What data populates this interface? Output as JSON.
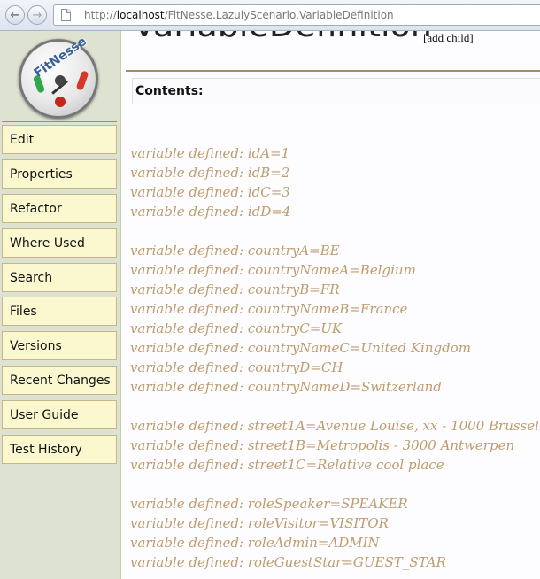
{
  "browser": {
    "url_prefix": "http://",
    "url_host": "localhost",
    "url_path": "/FitNesse.LazulyScenario.VariableDefinition",
    "back_glyph": "←",
    "forward_glyph": "→"
  },
  "logo": {
    "text": "FitNesse"
  },
  "sidebar": {
    "items": [
      {
        "label": "Edit"
      },
      {
        "label": "Properties"
      },
      {
        "label": "Refactor"
      },
      {
        "label": "Where Used"
      },
      {
        "label": "Search"
      },
      {
        "label": "Files"
      },
      {
        "label": "Versions"
      },
      {
        "label": "Recent Changes"
      },
      {
        "label": "User Guide"
      },
      {
        "label": "Test History"
      }
    ]
  },
  "main": {
    "title": "VariableDefinition",
    "add_child": "[add child]",
    "contents_label": "Contents:",
    "lines": [
      "variable defined: idA=1",
      "variable defined: idB=2",
      "variable defined: idC=3",
      "variable defined: idD=4",
      "variable defined: countryA=BE",
      "variable defined: countryNameA=Belgium",
      "variable defined: countryB=FR",
      "variable defined: countryNameB=France",
      "variable defined: countryC=UK",
      "variable defined: countryNameC=United Kingdom",
      "variable defined: countryD=CH",
      "variable defined: countryNameD=Switzerland",
      "variable defined: street1A=Avenue Louise, xx - 1000 Brussel",
      "variable defined: street1B=Metropolis - 3000 Antwerpen",
      "variable defined: street1C=Relative cool place",
      "variable defined: roleSpeaker=SPEAKER",
      "variable defined: roleVisitor=VISITOR",
      "variable defined: roleAdmin=ADMIN",
      "variable defined: roleGuestStar=GUEST_STAR"
    ]
  },
  "colors": {
    "sidebar_bg": "#dee3d1",
    "nav_item_bg": "#fbf8d0",
    "variable_text": "#bf9c6d",
    "rule": "#a98a5c"
  }
}
